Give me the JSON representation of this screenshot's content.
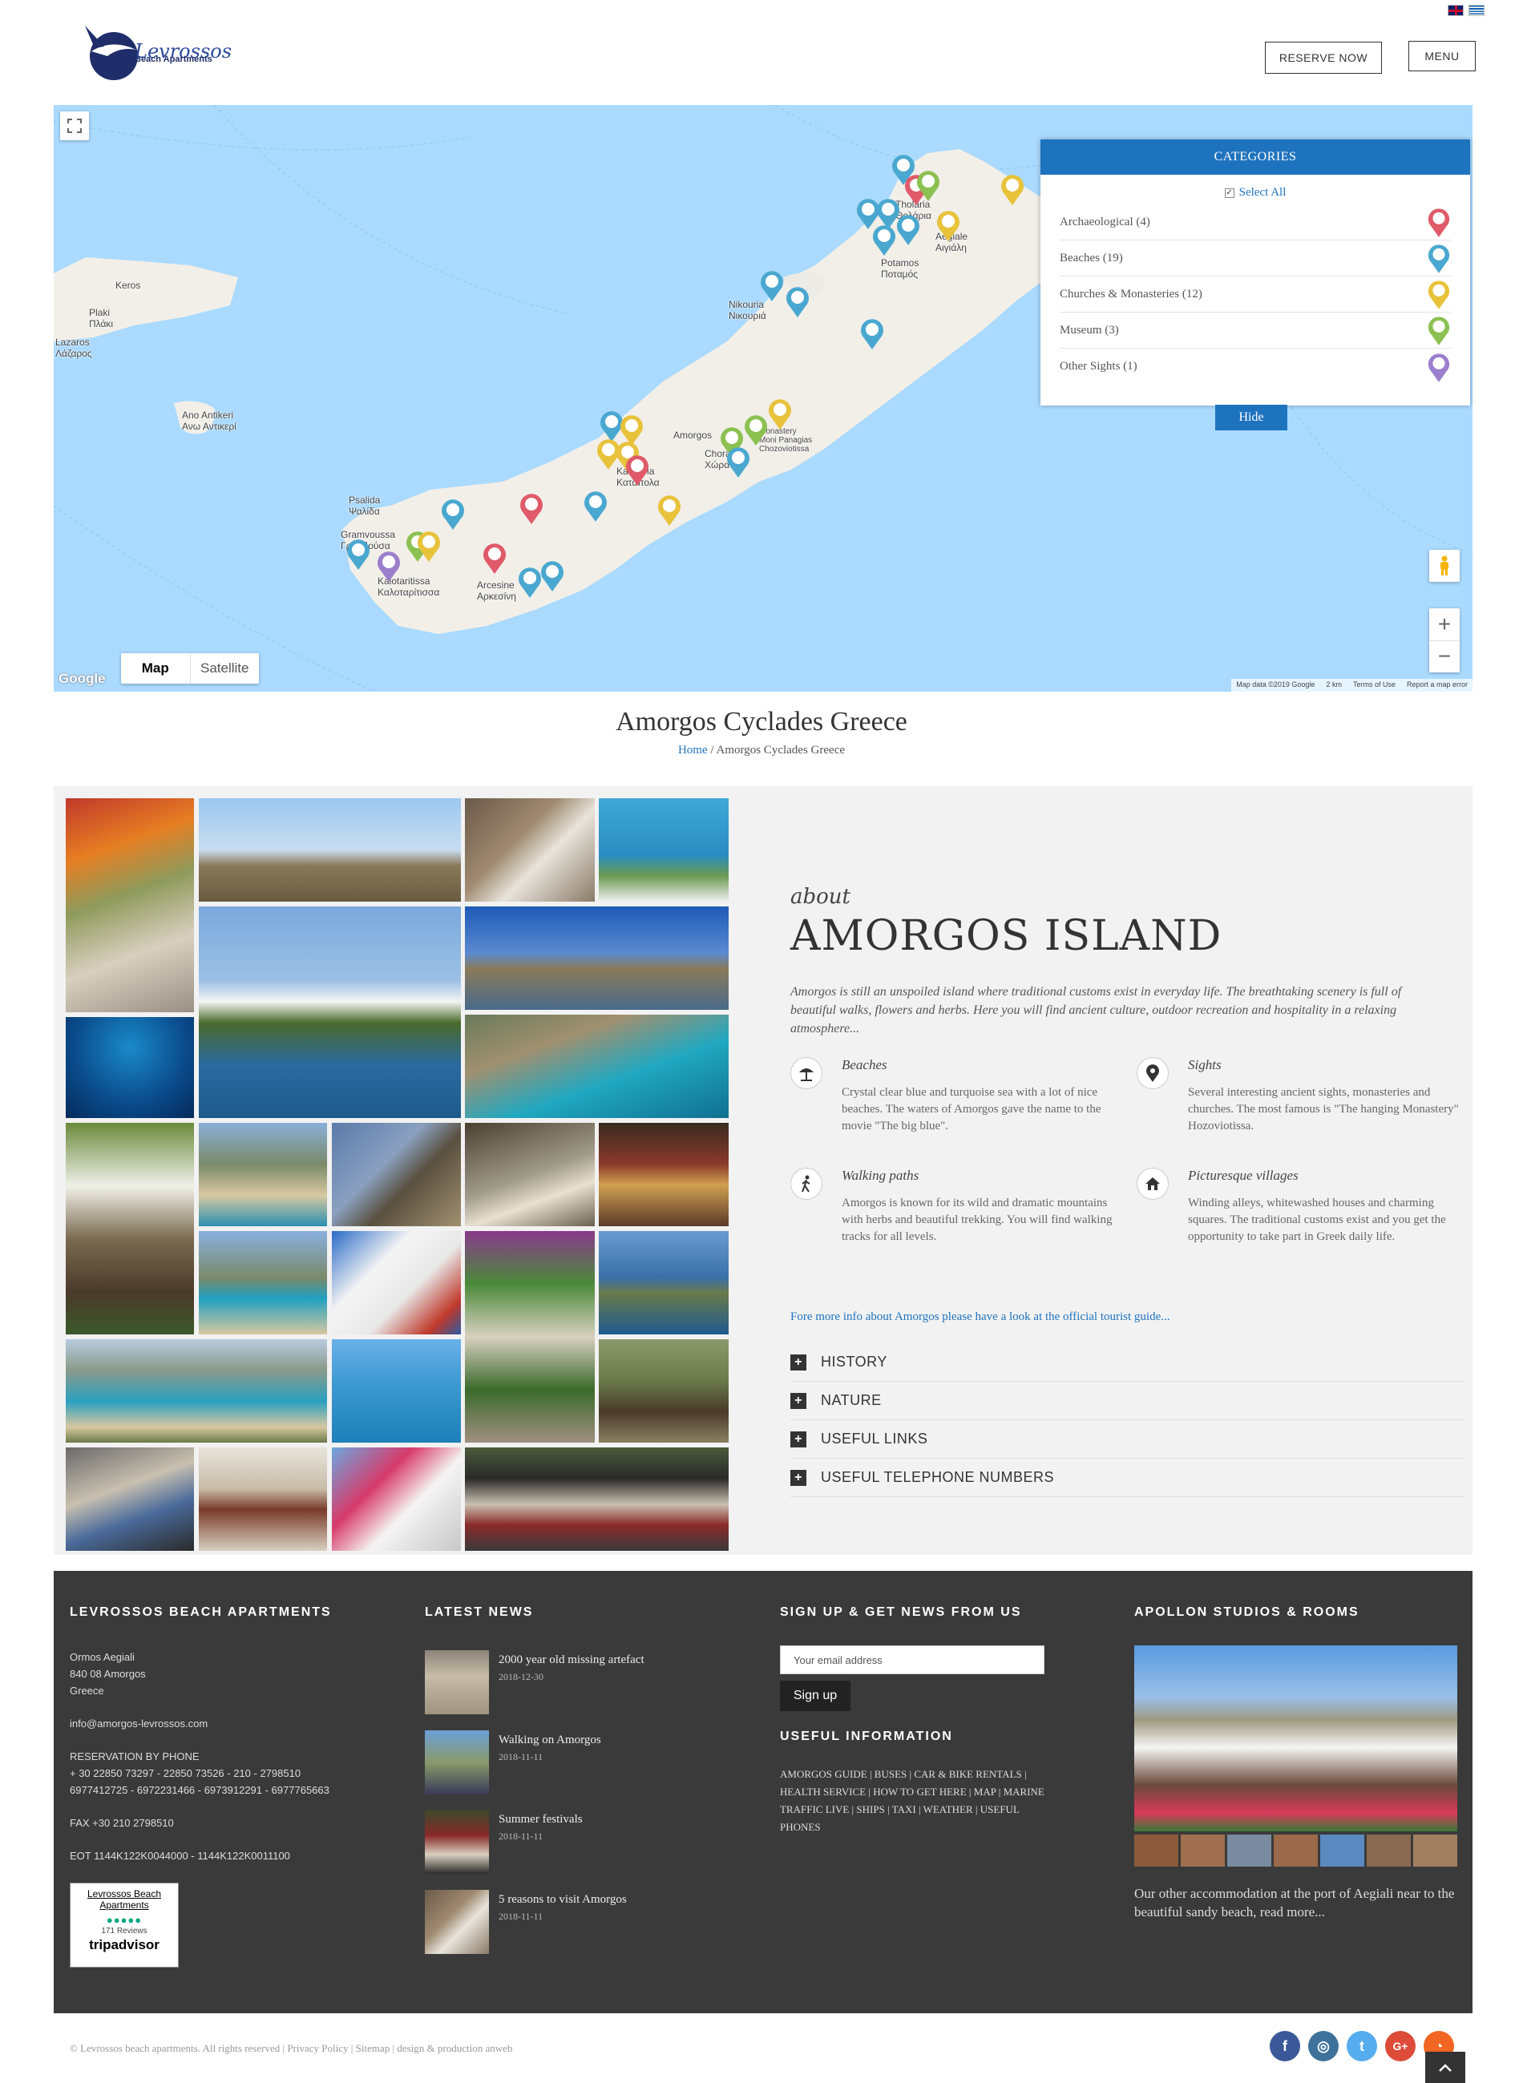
{
  "header": {
    "logo": {
      "name": "Levrossos",
      "subtitle": "Beach Apartments"
    },
    "reserve_label": "RESERVE NOW",
    "menu_label": "MENU"
  },
  "map": {
    "places": [
      "Keros",
      "Plaki\nΠλάκι",
      "Lazaros\nΛάζαρος",
      "Ano Antikeri\nΑνω Αντικερί",
      "Psalida\nΨαλίδα",
      "Gramvoussa\nΓραμβούσα",
      "Kalotaritissa\nΚαλοταρίτισσα",
      "Arcesine\nΑρκεσίνη",
      "Nikouria\nΝικουριά",
      "Amorgos",
      "Monastery\nMoni Panagias\nChozoviotissa",
      "Chora\nΧώρα",
      "Katapola\nΚατάπολα",
      "Tholaria\nΘολάρια",
      "Aegiale\nΑιγιάλη",
      "Potamos\nΠοταμός"
    ],
    "type_map": "Map",
    "type_satellite": "Satellite",
    "zoom_in": "+",
    "zoom_out": "−",
    "google": "Google",
    "attribution": [
      "Map data ©2019 Google",
      "2 km",
      "Terms of Use",
      "Report a map error"
    ]
  },
  "categories": {
    "title": "CATEGORIES",
    "select_all": "Select All",
    "items": [
      {
        "label": "Archaeological (4)",
        "color": "#e05a6a"
      },
      {
        "label": "Beaches (19)",
        "color": "#4aa8d0"
      },
      {
        "label": "Churches & Monasteries (12)",
        "color": "#e8c23a"
      },
      {
        "label": "Museum (3)",
        "color": "#8cc152"
      },
      {
        "label": "Other Sights (1)",
        "color": "#9b7fcc"
      }
    ],
    "hide_label": "Hide"
  },
  "page": {
    "title": "Amorgos Cyclades Greece",
    "breadcrumb_home": "Home",
    "breadcrumb_sep": "/",
    "breadcrumb_current": "Amorgos Cyclades Greece"
  },
  "about": {
    "small": "about",
    "big": "AMORGOS ISLAND",
    "intro": "Amorgos is still an unspoiled island where traditional customs exist in everyday life. The breathtaking scenery is full of beautiful walks, flowers and herbs. Here you will find ancient culture, outdoor recreation and hospitality in a relaxing atmosphere...",
    "features": [
      {
        "title": "Beaches",
        "text": "Crystal clear blue and turquoise sea with a lot of nice beaches. The waters of Amorgos gave the name to the movie \"The big blue\".",
        "icon": "umbrella-icon"
      },
      {
        "title": "Sights",
        "text": "Several interesting ancient sights, monasteries and churches. The most famous is \"The hanging Monastery\" Hozoviotissa.",
        "icon": "location-pin-icon"
      },
      {
        "title": "Walking paths",
        "text": "Amorgos is known for its wild and dramatic mountains with herbs and beautiful trekking. You will find walking tracks for all levels.",
        "icon": "hiker-icon"
      },
      {
        "title": "Picturesque villages",
        "text": "Winding alleys, whitewashed houses and charming squares. The traditional customs exist and you get the opportunity to take part in Greek daily life.",
        "icon": "home-icon"
      }
    ],
    "more_link": "Fore more info about Amorgos please have a look at the official tourist guide...",
    "accordion": [
      "HISTORY",
      "NATURE",
      "USEFUL LINKS",
      "USEFUL TELEPHONE NUMBERS"
    ]
  },
  "footer": {
    "col1": {
      "title": "LEVROSSOS BEACH APARTMENTS",
      "address": [
        "Ormos Aegiali",
        "840 08 Amorgos",
        "Greece"
      ],
      "email": "info@amorgos-levrossos.com",
      "reservation_label": "RESERVATION BY PHONE",
      "phones": [
        "+ 30 22850 73297 - 22850 73526 - 210 - 2798510",
        "6977412725 - 6972231466 - 6973912291 - 6977765663"
      ],
      "fax": "FAX +30 210 2798510",
      "eot": "EOT 1144K122K0044000 - 1144K122K0011100",
      "tripadvisor": {
        "name": "Levrossos Beach Apartments",
        "reviews": "171 Reviews",
        "brand": "tripadvisor"
      }
    },
    "col2": {
      "title": "LATEST NEWS",
      "items": [
        {
          "title": "2000 year old missing artefact",
          "date": "2018-12-30"
        },
        {
          "title": "Walking on Amorgos",
          "date": "2018-11-11"
        },
        {
          "title": "Summer festivals",
          "date": "2018-11-11"
        },
        {
          "title": "5 reasons to visit Amorgos",
          "date": "2018-11-11"
        }
      ]
    },
    "col3": {
      "title": "SIGN UP & GET NEWS FROM US",
      "email_placeholder": "Your email address",
      "signup_label": "Sign up",
      "useful_title": "USEFUL INFORMATION",
      "useful_links": "AMORGOS GUIDE | BUSES | CAR & BIKE RENTALS | HEALTH SERVICE | HOW TO GET HERE | MAP | MARINE TRAFFIC LIVE | SHIPS | TAXI | WEATHER | USEFUL PHONES"
    },
    "col4": {
      "title": "APOLLON STUDIOS & ROOMS",
      "text": "Our other accommodation at the port of Aegiali near to the beautiful sandy beach, read more..."
    }
  },
  "bottom": {
    "copyright": "© Levrossos beach apartments. All rights reserved | Privacy Policy | Sitemap | design & production anweb",
    "social": [
      {
        "name": "facebook-icon",
        "glyph": "f",
        "color": "#3b5998"
      },
      {
        "name": "instagram-icon",
        "glyph": "◎",
        "color": "#3f729b"
      },
      {
        "name": "twitter-icon",
        "glyph": "t",
        "color": "#55acee"
      },
      {
        "name": "googleplus-icon",
        "glyph": "G+",
        "color": "#dd4b39"
      },
      {
        "name": "rss-icon",
        "glyph": "◔",
        "color": "#f26522"
      }
    ]
  }
}
